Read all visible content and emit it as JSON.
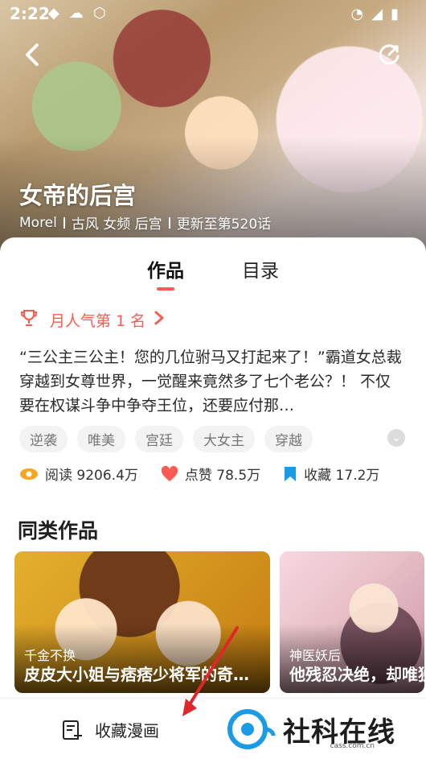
{
  "status": {
    "time": "2:22"
  },
  "header": {
    "title": "女帝的后宫",
    "author": "Morel",
    "genres": "古风 女频 后宫",
    "update": "更新至第520话"
  },
  "tabs": [
    {
      "label": "作品"
    },
    {
      "label": "目录"
    }
  ],
  "rank": {
    "label": "月人气第 1 名"
  },
  "description": "“三公主三公主！您的几位驸马又打起来了！”霸道女总裁穿越到女尊世界，一觉醒来竟然多了七个老公？！ 不仅要在权谋斗争中争夺王位，还要应付那…",
  "tags": [
    "逆袭",
    "唯美",
    "宫廷",
    "大女主",
    "穿越"
  ],
  "stats": {
    "read": "阅读 9206.4万",
    "like": "点赞 78.5万",
    "collect": "收藏 17.2万"
  },
  "similar": {
    "title": "同类作品",
    "items": [
      {
        "sub": "千金不换",
        "main": "皮皮大小姐与痞痞少将军的奇…"
      },
      {
        "sub": "神医妖后",
        "main": "他残忍决绝，却唯独"
      }
    ]
  },
  "bottom": {
    "collect_label": "收藏漫画"
  },
  "watermark": {
    "brand": "社科在线",
    "url": "cass.com.cn"
  },
  "colors": {
    "accent": "#ff5a4f",
    "blue": "#1a9be6",
    "orange": "#f5a623"
  }
}
